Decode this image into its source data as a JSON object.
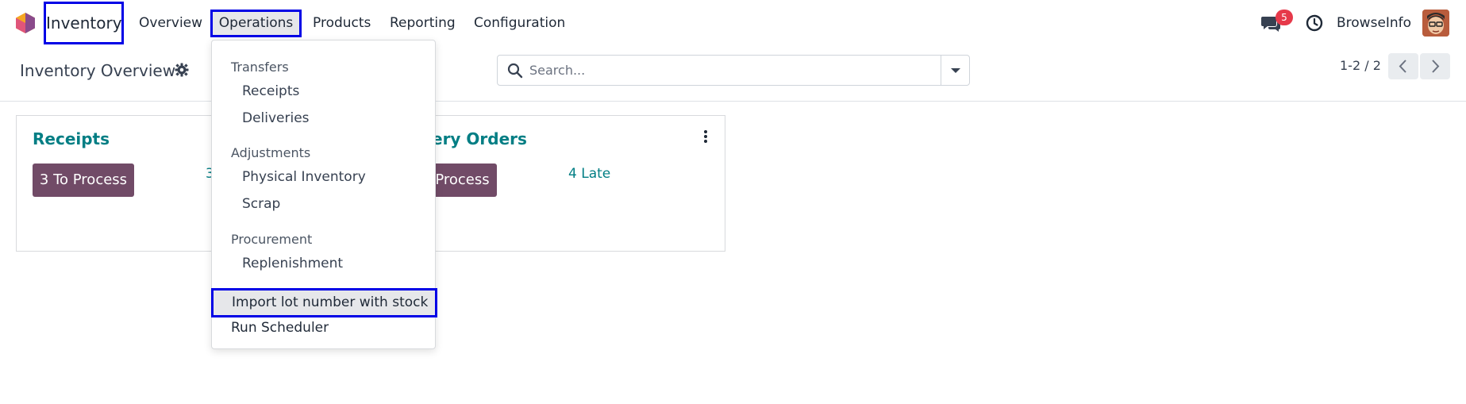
{
  "navbar": {
    "app_name": "Inventory",
    "menu": [
      "Overview",
      "Operations",
      "Products",
      "Reporting",
      "Configuration"
    ],
    "chat_count": "5",
    "username": "BrowseInfo"
  },
  "control_panel": {
    "title": "Inventory Overview",
    "search_placeholder": "Search...",
    "pager": "1-2 / 2"
  },
  "cards": [
    {
      "title": "Receipts",
      "process_label": "3 To Process",
      "late_label": "3"
    },
    {
      "title": "ery Orders",
      "process_label": "Process",
      "late_label": "4 Late"
    }
  ],
  "dropdown": {
    "sections": [
      {
        "header": "Transfers",
        "items": [
          "Receipts",
          "Deliveries"
        ]
      },
      {
        "header": "Adjustments",
        "items": [
          "Physical Inventory",
          "Scrap"
        ]
      },
      {
        "header": "Procurement",
        "items": [
          "Replenishment"
        ]
      }
    ],
    "extra_items": [
      "Import lot number with stock",
      "Run Scheduler"
    ]
  },
  "colors": {
    "accent_teal": "#017e84",
    "button_purple": "#714b67",
    "highlight_outline": "#0000e6",
    "badge_red": "#e6394a"
  },
  "icons": {
    "logo": "odoo-logo-icon",
    "chat": "chat-icon",
    "clock": "clock-icon",
    "gear": "gear-icon",
    "search": "search-icon",
    "toggle": "caret-down-icon",
    "prev": "chevron-left-icon",
    "next": "chevron-right-icon",
    "kebab": "kebab-menu-icon"
  }
}
